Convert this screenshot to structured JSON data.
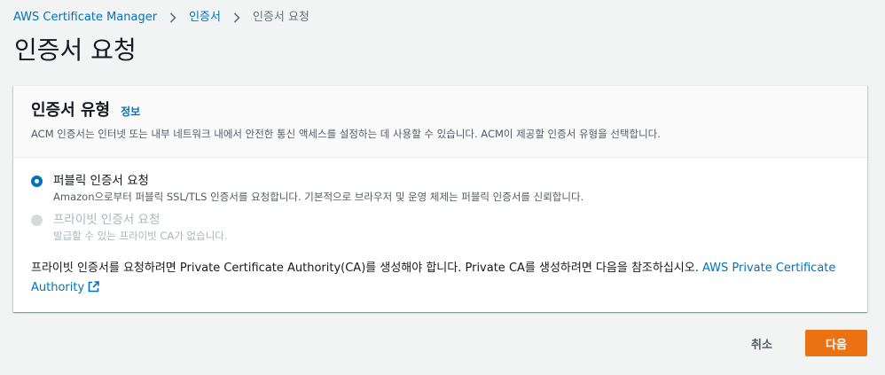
{
  "breadcrumb": {
    "items": [
      "AWS Certificate Manager",
      "인증서",
      "인증서 요청"
    ]
  },
  "page": {
    "title": "인증서 요청"
  },
  "card": {
    "title": "인증서 유형",
    "info_label": "정보",
    "description": "ACM 인증서는 인터넷 또는 내부 네트워크 내에서 안전한 통신 액세스를 설정하는 데 사용할 수 있습니다. ACM이 제공할 인증서 유형을 선택합니다.",
    "options": [
      {
        "label": "퍼블릭 인증서 요청",
        "description": "Amazon으로부터 퍼블릭 SSL/TLS 인증서를 요청합니다. 기본적으로 브라우저 및 운영 체제는 퍼블릭 인증서를 신뢰합니다.",
        "selected": true,
        "disabled": false
      },
      {
        "label": "프라이빗 인증서 요청",
        "description": "발급할 수 있는 프라이빗 CA가 없습니다.",
        "selected": false,
        "disabled": true
      }
    ],
    "note_text": "프라이빗 인증서를 요청하려면 Private Certificate Authority(CA)를 생성해야 합니다. Private CA를 생성하려면 다음을 참조하십시오. ",
    "note_link": "AWS Private Certificate Authority"
  },
  "footer": {
    "cancel_label": "취소",
    "next_label": "다음"
  },
  "colors": {
    "link": "#0073bb",
    "primary_button": "#ec7211",
    "background": "#f2f3f3"
  },
  "icons": {
    "breadcrumb_separator": "chevron-right-icon",
    "external_link": "external-link-icon"
  }
}
